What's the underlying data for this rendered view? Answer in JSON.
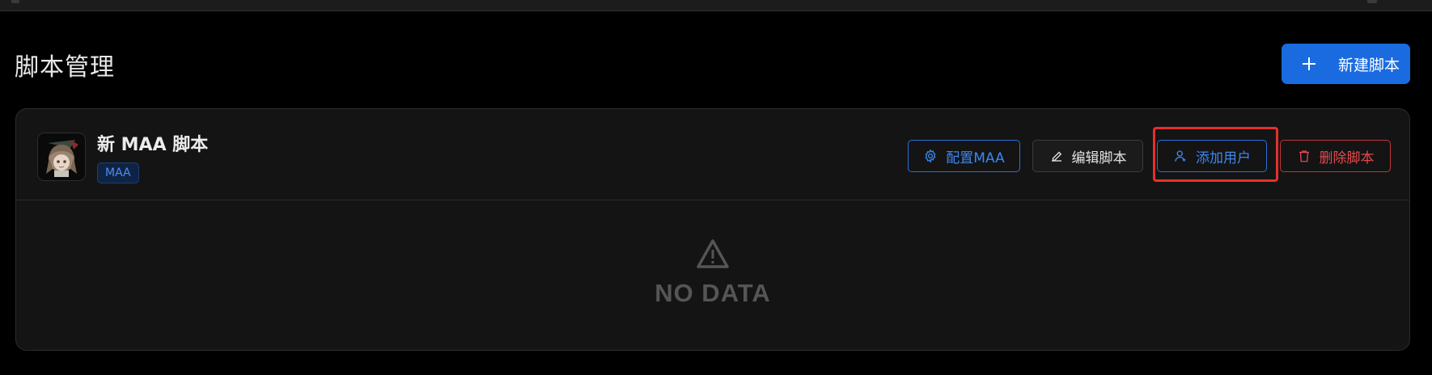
{
  "page": {
    "title": "脚本管理",
    "new_script_label": "新建脚本"
  },
  "script_card": {
    "name": "新 MAA 脚本",
    "tag": "MAA",
    "actions": {
      "config_label": "配置MAA",
      "edit_label": "编辑脚本",
      "add_user_label": "添加用户",
      "delete_label": "删除脚本"
    },
    "empty_state": {
      "text": "NO DATA",
      "icon": "warning-triangle-icon"
    }
  },
  "colors": {
    "background": "#000000",
    "card": "#141414",
    "primary": "#1a6be0",
    "accent_text": "#3d86f0",
    "danger": "#e5484d",
    "highlight": "#e5302c"
  }
}
